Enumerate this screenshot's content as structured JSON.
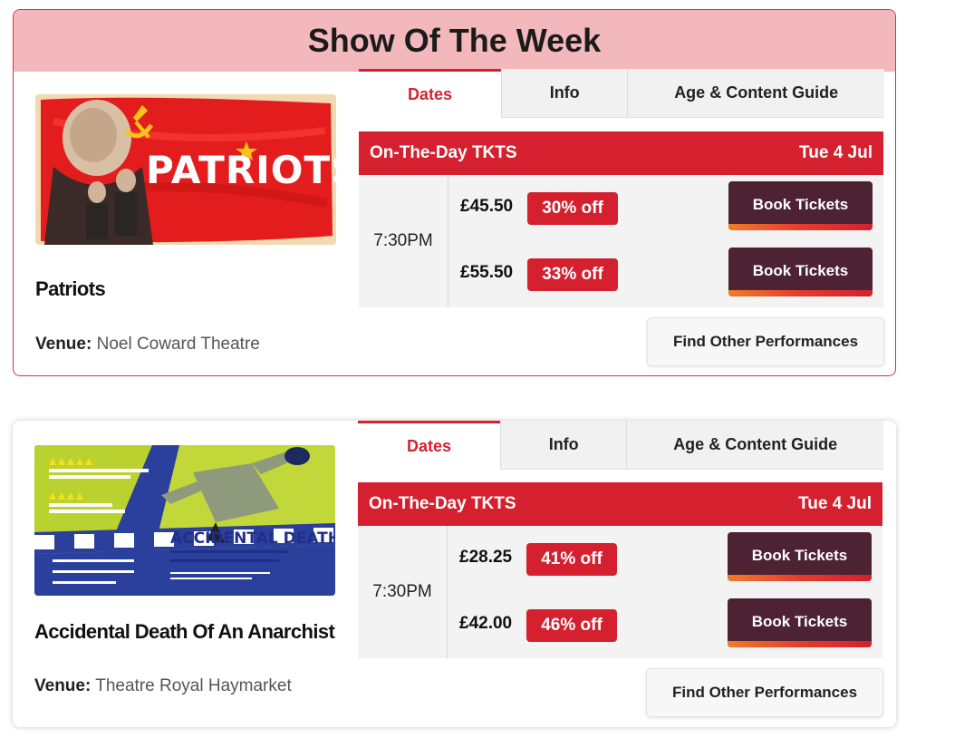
{
  "section_title": "Show Of The Week",
  "shows": [
    {
      "title": "Patriots",
      "venue_label": "Venue:",
      "venue": "Noel Coward Theatre",
      "poster_text": "PATRIOTS",
      "tabs": [
        "Dates",
        "Info",
        "Age & Content Guide"
      ],
      "deal_label": "On-The-Day TKTS",
      "date": "Tue 4 Jul",
      "time": "7:30PM",
      "prices": [
        {
          "price": "£45.50",
          "discount": "30% off",
          "button": "Book Tickets"
        },
        {
          "price": "£55.50",
          "discount": "33% off",
          "button": "Book Tickets"
        }
      ],
      "find_label": "Find Other Performances"
    },
    {
      "title": "Accidental Death Of An Anarchist",
      "venue_label": "Venue:",
      "venue": "Theatre Royal Haymarket",
      "poster_text": "ACCIDENTAL DEATH OF AN ANARCHIST",
      "tabs": [
        "Dates",
        "Info",
        "Age & Content Guide"
      ],
      "deal_label": "On-The-Day TKTS",
      "date": "Tue 4 Jul",
      "time": "7:30PM",
      "prices": [
        {
          "price": "£28.25",
          "discount": "41% off",
          "button": "Book Tickets"
        },
        {
          "price": "£42.00",
          "discount": "46% off",
          "button": "Book Tickets"
        }
      ],
      "find_label": "Find Other Performances"
    }
  ],
  "colors": {
    "accent_red": "#d4202f",
    "header_pink": "#f2b8bc",
    "button_plum": "#4d2233",
    "button_stripe": "#f07c27"
  }
}
